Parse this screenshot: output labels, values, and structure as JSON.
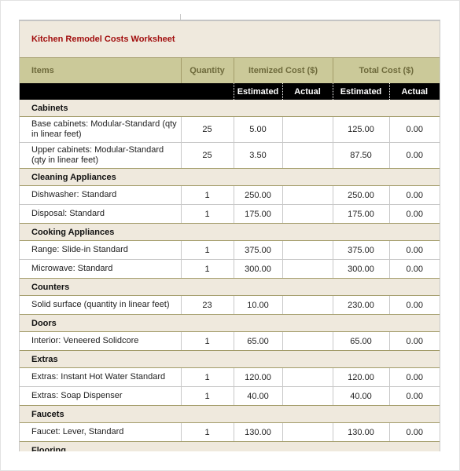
{
  "title": "Kitchen Remodel Costs Worksheet",
  "headers": {
    "items": "Items",
    "quantity": "Quantity",
    "itemized_cost": "Itemized Cost ($)",
    "total_cost": "Total Cost ($)",
    "estimated": "Estimated",
    "actual": "Actual"
  },
  "sections": [
    {
      "name": "Cabinets",
      "items": [
        {
          "item": "Base cabinets: Modular-Standard (qty in linear feet)",
          "qty": "25",
          "est": "5.00",
          "act": "",
          "total_est": "125.00",
          "total_act": "0.00"
        },
        {
          "item": "Upper cabinets: Modular-Standard (qty in linear feet)",
          "qty": "25",
          "est": "3.50",
          "act": "",
          "total_est": "87.50",
          "total_act": "0.00"
        }
      ]
    },
    {
      "name": "Cleaning Appliances",
      "items": [
        {
          "item": "Dishwasher: Standard",
          "qty": "1",
          "est": "250.00",
          "act": "",
          "total_est": "250.00",
          "total_act": "0.00"
        },
        {
          "item": "Disposal: Standard",
          "qty": "1",
          "est": "175.00",
          "act": "",
          "total_est": "175.00",
          "total_act": "0.00"
        }
      ]
    },
    {
      "name": "Cooking Appliances",
      "items": [
        {
          "item": "Range: Slide-in Standard",
          "qty": "1",
          "est": "375.00",
          "act": "",
          "total_est": "375.00",
          "total_act": "0.00"
        },
        {
          "item": "Microwave: Standard",
          "qty": "1",
          "est": "300.00",
          "act": "",
          "total_est": "300.00",
          "total_act": "0.00"
        }
      ]
    },
    {
      "name": "Counters",
      "items": [
        {
          "item": "Solid surface (quantity in linear feet)",
          "qty": "23",
          "est": "10.00",
          "act": "",
          "total_est": "230.00",
          "total_act": "0.00"
        }
      ]
    },
    {
      "name": "Doors",
      "items": [
        {
          "item": "Interior: Veneered Solidcore",
          "qty": "1",
          "est": "65.00",
          "act": "",
          "total_est": "65.00",
          "total_act": "0.00"
        }
      ]
    },
    {
      "name": "Extras",
      "items": [
        {
          "item": "Extras: Instant Hot Water Standard",
          "qty": "1",
          "est": "120.00",
          "act": "",
          "total_est": "120.00",
          "total_act": "0.00"
        },
        {
          "item": "Extras: Soap Dispenser",
          "qty": "1",
          "est": "40.00",
          "act": "",
          "total_est": "40.00",
          "total_act": "0.00"
        }
      ]
    },
    {
      "name": "Faucets",
      "items": [
        {
          "item": "Faucet: Lever, Standard",
          "qty": "1",
          "est": "130.00",
          "act": "",
          "total_est": "130.00",
          "total_act": "0.00"
        }
      ]
    },
    {
      "name": "Flooring",
      "items": []
    }
  ]
}
